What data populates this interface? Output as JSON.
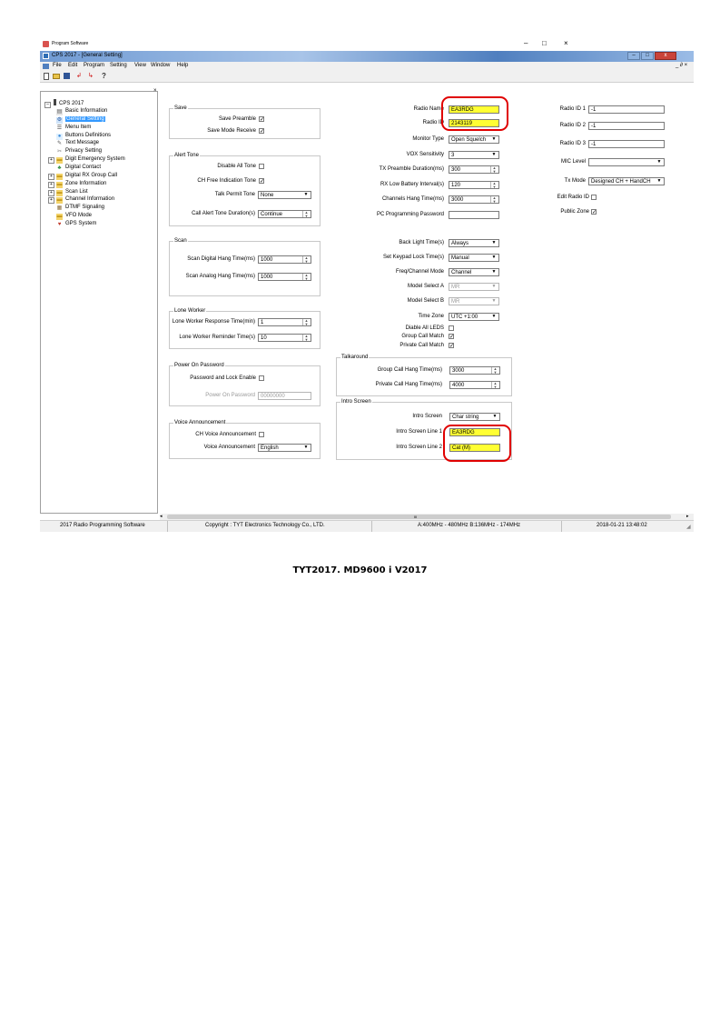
{
  "outer_window": {
    "title": "Program Software",
    "controls": [
      "–",
      "□",
      "×"
    ]
  },
  "app_window": {
    "title": "CPS 2017 - [General Setting]"
  },
  "menu": [
    "File",
    "Edit",
    "Program",
    "Setting",
    "View",
    "Window",
    "Help"
  ],
  "mdi_controls": "_ ∂ ×",
  "toolbar_icons": [
    "new-file-icon",
    "open-folder-icon",
    "save-icon",
    "read-radio-icon",
    "write-radio-icon",
    "help-icon"
  ],
  "tree": {
    "root": "CPS 2017",
    "items": [
      {
        "label": "Basic Information",
        "icon": "doc"
      },
      {
        "label": "General Setting",
        "icon": "gear",
        "selected": true
      },
      {
        "label": "Menu Item",
        "icon": "menu"
      },
      {
        "label": "Buttons Definitions",
        "icon": "button"
      },
      {
        "label": "Text Message",
        "icon": "msg"
      },
      {
        "label": "Privacy Setting",
        "icon": "key"
      },
      {
        "label": "Digit Emergency System",
        "icon": "folder"
      },
      {
        "label": "Digital Contact",
        "icon": "contact"
      },
      {
        "label": "Digital RX Group Call",
        "icon": "folder"
      },
      {
        "label": "Zone Information",
        "icon": "folder"
      },
      {
        "label": "Scan List",
        "icon": "folder"
      },
      {
        "label": "Channel Information",
        "icon": "folder"
      },
      {
        "label": "DTMF Signaling",
        "icon": "dtmf"
      },
      {
        "label": "VFO Mode",
        "icon": "folder"
      },
      {
        "label": "GPS System",
        "icon": "gps"
      }
    ]
  },
  "save_group": {
    "title": "Save",
    "save_preamble": "Save Preamble",
    "save_preamble_checked": true,
    "save_mode_receive": "Save Mode Receive",
    "save_mode_receive_checked": true
  },
  "alert_group": {
    "title": "Alert Tone",
    "disable_all_tone": "Disable All Tone",
    "disable_all_tone_checked": false,
    "ch_free": "CH Free Indication Tone",
    "ch_free_checked": true,
    "talk_permit_label": "Talk Permit Tone",
    "talk_permit_value": "None",
    "call_alert_label": "Call Alert Tone Duration(s)",
    "call_alert_value": "Continue"
  },
  "scan_group": {
    "title": "Scan",
    "digital_label": "Scan Digital Hang Time(ms)",
    "digital_value": "1000",
    "analog_label": "Scan Analog Hang Time(ms)",
    "analog_value": "1000"
  },
  "lone_group": {
    "title": "Lone Worker",
    "response_label": "Lone Worker Response Time(min)",
    "response_value": "1",
    "reminder_label": "Lone Worker Reminder Time(s)",
    "reminder_value": "10"
  },
  "power_group": {
    "title": "Power On Password",
    "lock_label": "Password and Lock Enable",
    "lock_checked": false,
    "password_label": "Power On Password",
    "password_value": "00000000"
  },
  "voice_group": {
    "title": "Voice Announcement",
    "ch_voice_label": "CH Voice Announcement",
    "ch_voice_checked": false,
    "voice_label": "Voice Announcement",
    "voice_value": "English"
  },
  "middle": {
    "radio_name_label": "Radio Name",
    "radio_name_value": "EA3RDG",
    "radio_id_label": "Radio ID",
    "radio_id_value": "2143119",
    "monitor_type_label": "Monitor Type",
    "monitor_type_value": "Open Squelch",
    "vox_label": "VOX Sensitivity",
    "vox_value": "3",
    "tx_preamble_label": "TX Preamble Duration(ms)",
    "tx_preamble_value": "300",
    "rx_battery_label": "RX Low Battery Interval(s)",
    "rx_battery_value": "120",
    "channels_hang_label": "Channels Hang Time(ms)",
    "channels_hang_value": "3000",
    "pc_password_label": "PC Programming Password",
    "pc_password_value": "",
    "backlight_label": "Back Light Time(s)",
    "backlight_value": "Always",
    "keypad_lock_label": "Set Keypad Lock Time(s)",
    "keypad_lock_value": "Manual",
    "freq_mode_label": "Freq/Channel Mode",
    "freq_mode_value": "Channel",
    "model_a_label": "Model Select A",
    "model_a_value": "MR",
    "model_b_label": "Model Select B",
    "model_b_value": "MR",
    "time_zone_label": "Time Zone",
    "time_zone_value": "UTC +1:00",
    "disable_leds_label": "Diable All LEDS",
    "disable_leds_checked": false,
    "group_call_match_label": "Group Call Match",
    "group_call_match_checked": true,
    "private_call_match_label": "Private Call Match",
    "private_call_match_checked": true
  },
  "talkaround_group": {
    "title": "Talkaround",
    "group_hang_label": "Group Call Hang Time(ms)",
    "group_hang_value": "3000",
    "private_hang_label": "Private Call Hang Time(ms)",
    "private_hang_value": "4000"
  },
  "intro_group": {
    "title": "Intro Screen",
    "intro_label": "Intro Screen",
    "intro_value": "Char string",
    "line1_label": "Intro Screen Line 1",
    "line1_value": "EA3RDG",
    "line2_label": "Intro Screen Line 2",
    "line2_value": "Cat (M)"
  },
  "right": {
    "radio_id1_label": "Radio ID 1",
    "radio_id1_value": "-1",
    "radio_id2_label": "Radio ID 2",
    "radio_id2_value": "-1",
    "radio_id3_label": "Radio ID 3",
    "radio_id3_value": "-1",
    "mic_level_label": "MIC Level",
    "mic_level_value": "",
    "tx_mode_label": "Tx Mode",
    "tx_mode_value": "Designed CH + HandCH",
    "edit_radio_id_label": "Edit Radio ID",
    "edit_radio_id_checked": false,
    "public_zone_label": "Public Zone",
    "public_zone_checked": true
  },
  "scrollbar": {
    "thumb_text": "III"
  },
  "status_bar": {
    "app": "2017 Radio Programming Software",
    "copyright": "Copyright : TYT Electronics Technology Co., LTD.",
    "band": "A:400MHz - 480MHz B:136MHz - 174MHz",
    "datetime": "2018-01-21 13:48:02"
  },
  "caption": "TYT2017. MD9600 i V2017",
  "colors": {
    "highlight": "#ffff33",
    "annotation": "#e00000",
    "selection": "#3399ff",
    "titlebar": "#5a86c4"
  }
}
